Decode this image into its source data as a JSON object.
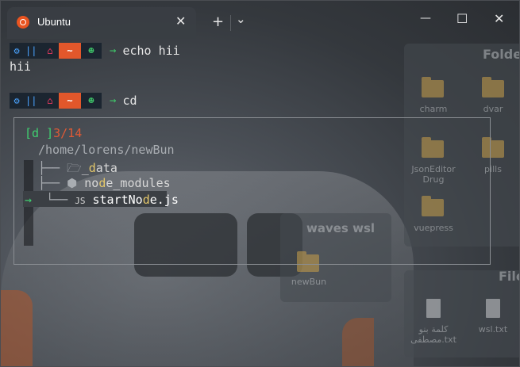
{
  "window": {
    "tab_title": "Ubuntu",
    "tab_close": "✕",
    "new_tab": "+",
    "dropdown": "⌄",
    "minimize": "—",
    "maximize": "☐",
    "close": "✕"
  },
  "prompt": {
    "os_glyph": "⚙",
    "pipe": "||",
    "home_glyph": "⌂",
    "dir": "~",
    "smile": "☻",
    "arrow": "→"
  },
  "terminal": {
    "cmd1": "echo hii",
    "out1": "hii",
    "cmd2": "cd"
  },
  "picker": {
    "filter_prefix": "[d ]",
    "count": "3/14",
    "path": "/home/lorens/newBun",
    "items": [
      {
        "branch": "├──",
        "icon": "🗁",
        "name_pre": "_",
        "name_hl": "d",
        "name_post": "ata"
      },
      {
        "branch": "├──",
        "icon": "⬢",
        "name_pre": "no",
        "name_hl": "d",
        "name_post": "e_modules"
      },
      {
        "branch": "└──",
        "icon": "JS",
        "name_pre": "startNo",
        "name_hl": "d",
        "name_post": "e.js",
        "selected": true
      }
    ],
    "selector": "→"
  },
  "desktop": {
    "folders_heading": "Folde",
    "files_heading": "File",
    "group_title": "waves wsl",
    "icons": [
      "charm",
      "dvar",
      "JsonEditor Drug",
      "pills",
      "vuepress",
      "newBun"
    ],
    "files": [
      "كلمة بنو مصطفى.txt",
      "wsl.txt"
    ]
  }
}
